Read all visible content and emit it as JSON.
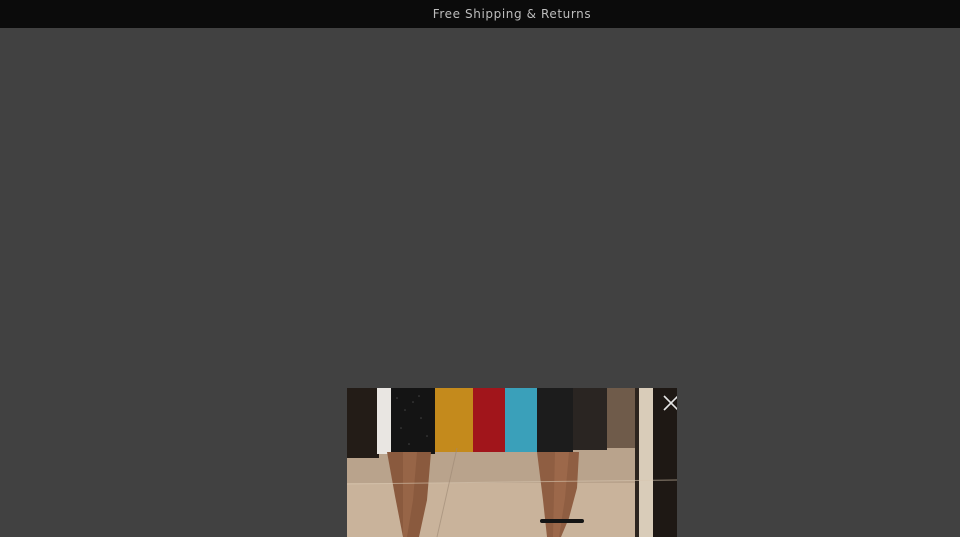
{
  "announcement": {
    "text": "Free Shipping & Returns"
  },
  "modal": {
    "image_subject": "woman-in-colorful-striped-skirt-and-black-heels",
    "close_icon": "close-icon"
  },
  "colors": {
    "announcement_bg": "#0b0b0b",
    "announcement_text": "#bdbdbd",
    "overlay": "#414141",
    "stripe_white": "#e9e6e2",
    "stripe_black": "#141414",
    "stripe_mustard": "#c48a1c",
    "stripe_red": "#a1151b",
    "stripe_teal": "#3aa0ba",
    "stripe_dark": "#2a2522"
  }
}
